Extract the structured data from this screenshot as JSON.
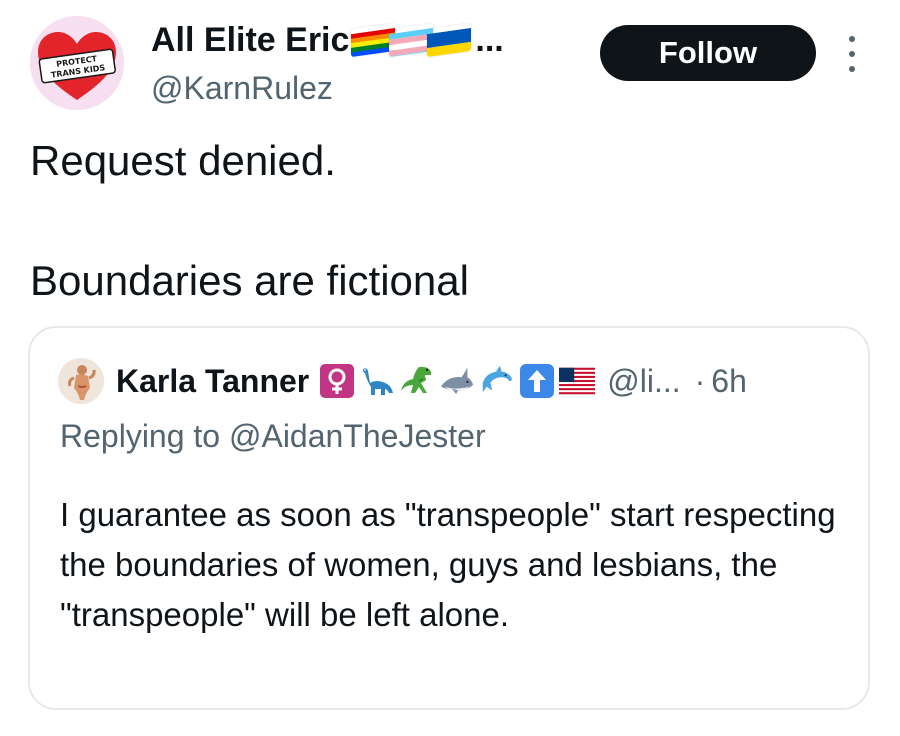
{
  "tweet": {
    "author": {
      "display_name": "All Elite Eric",
      "name_overflow": "...",
      "handle": "@KarnRulez",
      "avatar_text_line1": "PROTECT",
      "avatar_text_line2": "TRANS KIDS",
      "name_flags": [
        "rainbow-pride-flag-icon",
        "transgender-flag-icon",
        "ukraine-flag-icon"
      ]
    },
    "follow_label": "Follow",
    "more_icon": "more-vertical-icon",
    "text_line1": "Request denied.",
    "text_line2": "Boundaries are fictional"
  },
  "quote": {
    "author_name": "Karla Tanner",
    "emojis": [
      "female-sign-icon",
      "sauropod-icon",
      "t-rex-icon",
      "shark-icon",
      "dolphin-icon",
      "up-arrow-icon",
      "us-flag-icon"
    ],
    "handle": "@li...",
    "separator": "·",
    "time": "6h",
    "replying_to": "Replying to @AidanTheJester",
    "body": "I guarantee as soon as \"transpeople\" start respecting the boundaries of women, guys and lesbians, the \"transpeople\" will be left alone."
  },
  "colors": {
    "text_primary": "#0f1419",
    "text_secondary": "#536471",
    "border": "#e6e9ec",
    "button_bg": "#0f1419",
    "avatar_bg": "#f6dff0",
    "heart_red": "#e3242b"
  }
}
